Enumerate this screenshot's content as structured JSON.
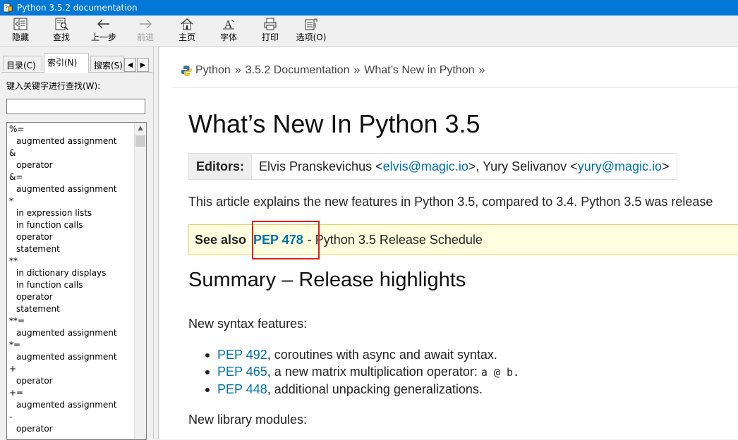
{
  "window": {
    "title": "Python 3.5.2 documentation"
  },
  "toolbar": {
    "hide": "隐藏",
    "find": "查找",
    "back": "上一步",
    "forward": "前进",
    "home": "主页",
    "font": "字体",
    "print": "打印",
    "options": "选项(O)"
  },
  "left_tabs": {
    "contents": "目录(C)",
    "index": "索引(N)",
    "search": "搜索(S)"
  },
  "index_pane": {
    "keyword_label": "键入关键字进行查找(W):",
    "keyword_value": "",
    "items": [
      {
        "text": "%=",
        "sub": false
      },
      {
        "text": "augmented assignment",
        "sub": true
      },
      {
        "text": "&",
        "sub": false
      },
      {
        "text": "operator",
        "sub": true
      },
      {
        "text": "&=",
        "sub": false
      },
      {
        "text": "augmented assignment",
        "sub": true
      },
      {
        "text": "*",
        "sub": false
      },
      {
        "text": "in expression lists",
        "sub": true
      },
      {
        "text": "in function calls",
        "sub": true
      },
      {
        "text": "operator",
        "sub": true
      },
      {
        "text": "statement",
        "sub": true
      },
      {
        "text": "**",
        "sub": false
      },
      {
        "text": "in dictionary displays",
        "sub": true
      },
      {
        "text": "in function calls",
        "sub": true
      },
      {
        "text": "operator",
        "sub": true
      },
      {
        "text": "statement",
        "sub": true
      },
      {
        "text": "**=",
        "sub": false
      },
      {
        "text": "augmented assignment",
        "sub": true
      },
      {
        "text": "*=",
        "sub": false
      },
      {
        "text": "augmented assignment",
        "sub": true
      },
      {
        "text": "+",
        "sub": false
      },
      {
        "text": "operator",
        "sub": true
      },
      {
        "text": "+=",
        "sub": false
      },
      {
        "text": "augmented assignment",
        "sub": true
      },
      {
        "text": "-",
        "sub": false
      },
      {
        "text": "operator",
        "sub": true
      }
    ]
  },
  "content": {
    "breadcrumb": [
      "Python",
      "3.5.2 Documentation",
      "What’s New in Python"
    ],
    "breadcrumb_sep": "»",
    "title": "What’s New In Python 3.5",
    "editors_label": "Editors:",
    "editors": {
      "name1": "Elvis Pranskevichus <",
      "email1": "elvis@magic.io",
      "mid": ">, Yury Selivanov <",
      "email2": "yury@magic.io",
      "end": ">"
    },
    "intro": "This article explains the new features in Python 3.5, compared to 3.4. Python 3.5 was release",
    "see_also": {
      "label": "See also",
      "link": "PEP 478",
      "text": "- Python 3.5 Release Schedule"
    },
    "summary_heading": "Summary – Release highlights",
    "new_syntax": "New syntax features:",
    "features": [
      {
        "link": "PEP 492",
        "text": ", coroutines with async and await syntax.",
        "code": ""
      },
      {
        "link": "PEP 465",
        "text": ", a new matrix multiplication operator: ",
        "code": "a @ b."
      },
      {
        "link": "PEP 448",
        "text": ", additional unpacking generalizations.",
        "code": ""
      }
    ],
    "new_modules": "New library modules:"
  }
}
